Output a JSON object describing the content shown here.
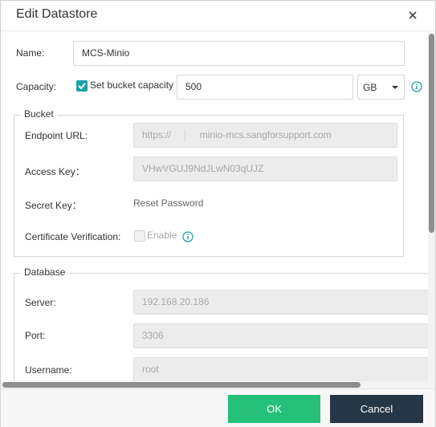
{
  "dialog": {
    "title": "Edit Datastore",
    "close_icon": "close-icon"
  },
  "form": {
    "name_label": "Name:",
    "name_value": "MCS-Minio",
    "capacity_label": "Capacity:",
    "capacity_checkbox_label": "Set bucket capacity",
    "capacity_checked": true,
    "capacity_value": "500",
    "capacity_unit": "GB",
    "capacity_info_icon": "info-icon"
  },
  "bucket": {
    "legend": "Bucket",
    "endpoint_label": "Endpoint URL:",
    "endpoint_scheme": "https://",
    "endpoint_host": "minio-mcs.sangforsupport.com",
    "access_key_label": "Access Key：",
    "access_key_value": "VHwVGUJ9NdJLwN03qUJZ",
    "secret_key_label": "Secret Key：",
    "secret_key_link": "Reset Password",
    "cert_label": "Certificate Verification:",
    "cert_checkbox_label": "Enable",
    "cert_checked": false
  },
  "database": {
    "legend": "Database",
    "server_label": "Server:",
    "server_value": "192.168.20.186",
    "port_label": "Port:",
    "port_value": "3306",
    "username_label": "Username:",
    "username_value": "root"
  },
  "footer": {
    "ok_label": "OK",
    "cancel_label": "Cancel"
  },
  "colors": {
    "accent": "#1aa3a8",
    "ok_button": "#25c07a",
    "cancel_button": "#253646"
  }
}
